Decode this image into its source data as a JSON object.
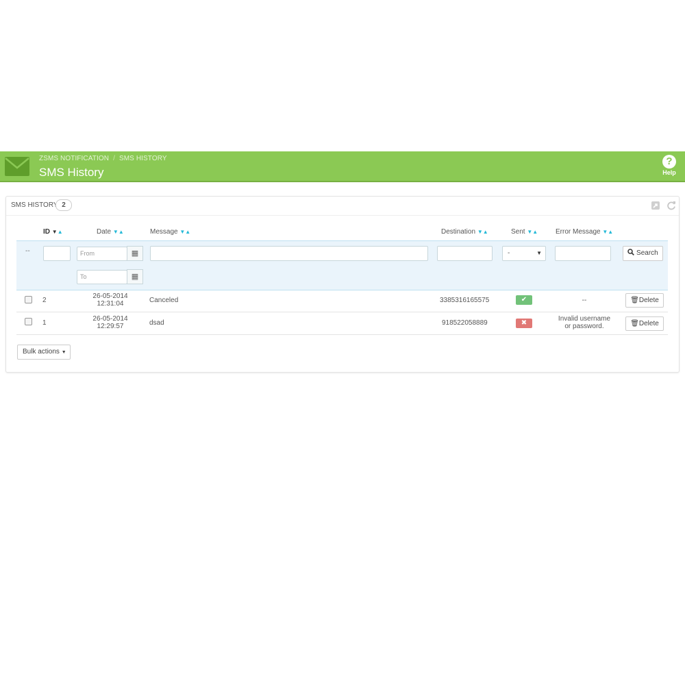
{
  "header": {
    "breadcrumb": [
      "ZSMS NOTIFICATION",
      "SMS HISTORY"
    ],
    "title": "SMS History",
    "help_label": "Help",
    "brand_color": "#8bc954",
    "icons": {
      "module": "envelope-icon",
      "help": "question-circle-icon"
    }
  },
  "panel": {
    "title": "SMS HISTORY",
    "count": "2",
    "toolbar_icons": [
      "export-icon",
      "refresh-icon"
    ]
  },
  "table": {
    "columns": {
      "id": "ID",
      "date": "Date",
      "message": "Message",
      "destination": "Destination",
      "sent": "Sent",
      "error": "Error Message"
    },
    "filters": {
      "id_placeholder": "--",
      "from_placeholder": "From",
      "to_placeholder": "To",
      "sent_selected": "-",
      "search_label": "Search"
    },
    "rows": [
      {
        "id": "2",
        "date": "26-05-2014",
        "time": "12:31:04",
        "message": "Canceled",
        "destination": "3385316165575",
        "sent": true,
        "error_line1": "--",
        "error_line2": "",
        "delete_label": "Delete"
      },
      {
        "id": "1",
        "date": "26-05-2014",
        "time": "12:29:57",
        "message": "dsad",
        "destination": "918522058889",
        "sent": false,
        "error_line1": "Invalid username",
        "error_line2": "or password.",
        "delete_label": "Delete"
      }
    ]
  },
  "bulk_actions_label": "Bulk actions",
  "colors": {
    "success": "#72c279",
    "danger": "#e17875",
    "sort_active": "#25b9d7",
    "filter_bg": "#eaf4fb"
  }
}
